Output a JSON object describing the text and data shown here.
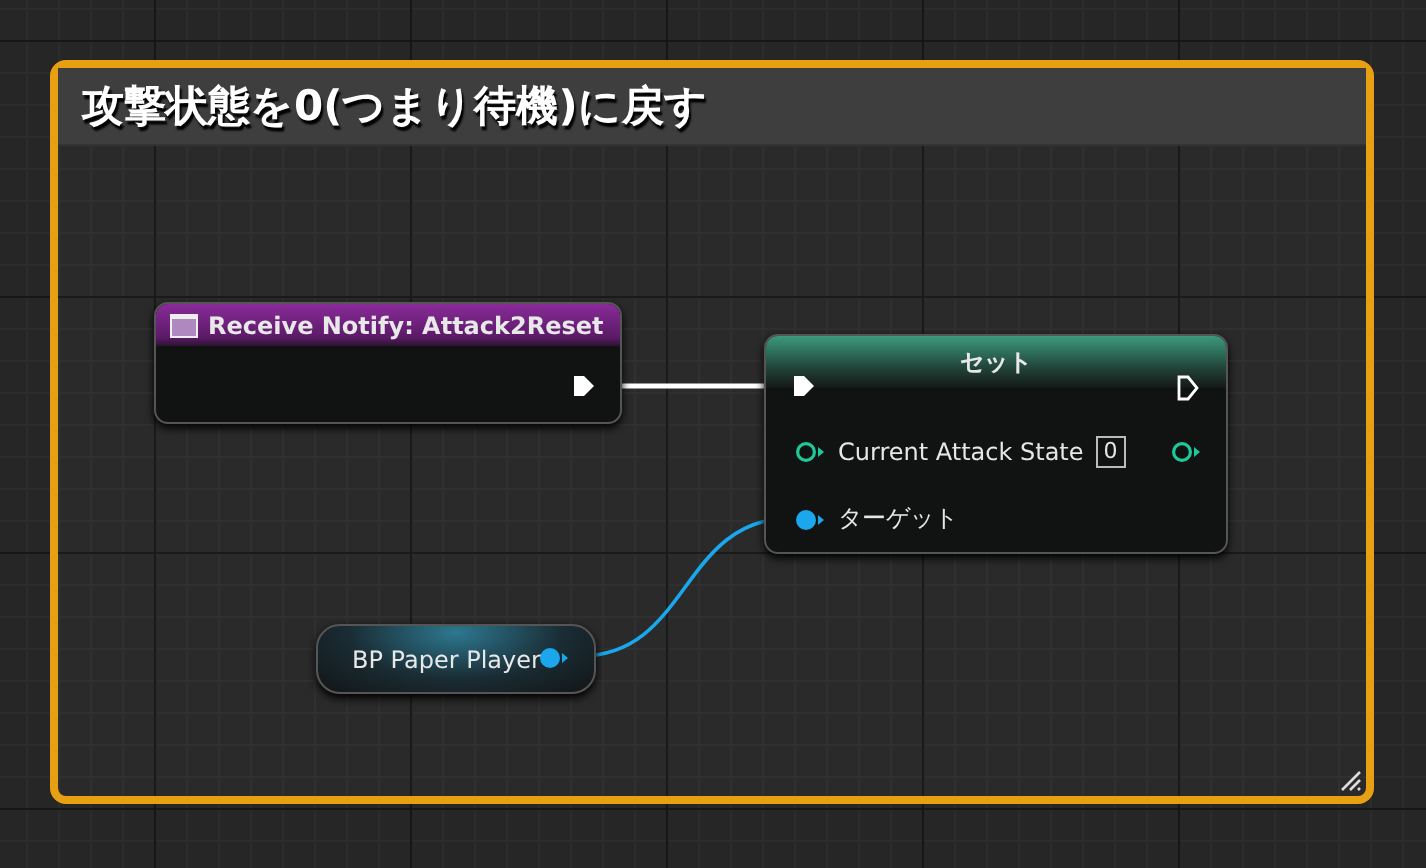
{
  "comment": {
    "title": "攻撃状態を0(つまり待機)に戻す"
  },
  "nodes": [
    {
      "kind": "event",
      "title": "Receive Notify: Attack2Reset"
    },
    {
      "kind": "set",
      "title": "セット",
      "pins": [
        {
          "kind": "integer",
          "label": "Current Attack State",
          "value": "0"
        },
        {
          "kind": "object",
          "label": "ターゲット"
        }
      ]
    },
    {
      "kind": "variable",
      "title": "BP Paper Player"
    }
  ]
}
